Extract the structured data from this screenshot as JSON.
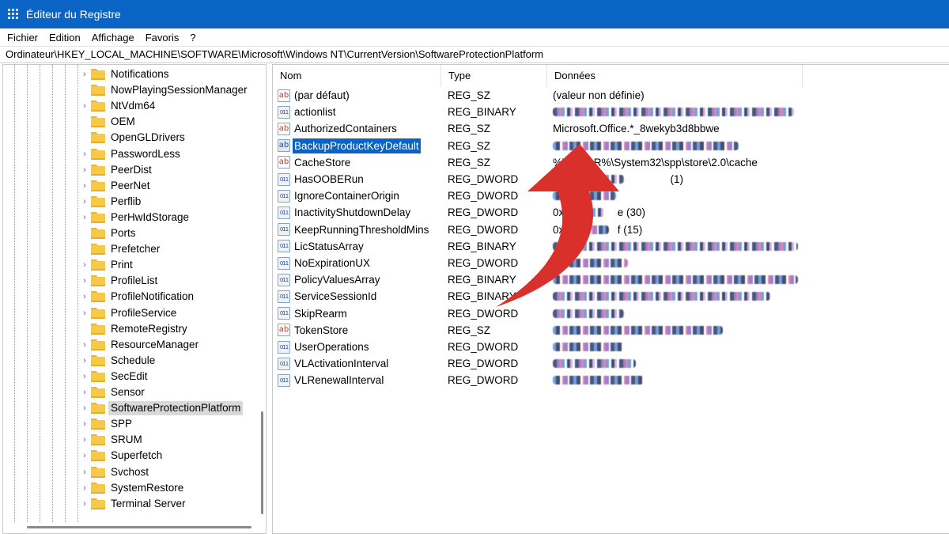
{
  "window": {
    "title": "Éditeur du Registre"
  },
  "menu": [
    "Fichier",
    "Edition",
    "Affichage",
    "Favoris",
    "?"
  ],
  "address": "Ordinateur\\HKEY_LOCAL_MACHINE\\SOFTWARE\\Microsoft\\Windows NT\\CurrentVersion\\SoftwareProtectionPlatform",
  "tree": {
    "items": [
      {
        "label": "Notifications",
        "expandable": true
      },
      {
        "label": "NowPlayingSessionManager",
        "expandable": false
      },
      {
        "label": "NtVdm64",
        "expandable": true
      },
      {
        "label": "OEM",
        "expandable": false
      },
      {
        "label": "OpenGLDrivers",
        "expandable": false
      },
      {
        "label": "PasswordLess",
        "expandable": true
      },
      {
        "label": "PeerDist",
        "expandable": true
      },
      {
        "label": "PeerNet",
        "expandable": true
      },
      {
        "label": "Perflib",
        "expandable": true
      },
      {
        "label": "PerHwIdStorage",
        "expandable": true
      },
      {
        "label": "Ports",
        "expandable": false
      },
      {
        "label": "Prefetcher",
        "expandable": false
      },
      {
        "label": "Print",
        "expandable": true
      },
      {
        "label": "ProfileList",
        "expandable": true
      },
      {
        "label": "ProfileNotification",
        "expandable": true
      },
      {
        "label": "ProfileService",
        "expandable": true
      },
      {
        "label": "RemoteRegistry",
        "expandable": false
      },
      {
        "label": "ResourceManager",
        "expandable": true
      },
      {
        "label": "Schedule",
        "expandable": true
      },
      {
        "label": "SecEdit",
        "expandable": true
      },
      {
        "label": "Sensor",
        "expandable": true
      },
      {
        "label": "SoftwareProtectionPlatform",
        "expandable": true,
        "selected": true
      },
      {
        "label": "SPP",
        "expandable": true
      },
      {
        "label": "SRUM",
        "expandable": true
      },
      {
        "label": "Superfetch",
        "expandable": true
      },
      {
        "label": "Svchost",
        "expandable": true
      },
      {
        "label": "SystemRestore",
        "expandable": true
      },
      {
        "label": "Terminal Server",
        "expandable": true
      }
    ]
  },
  "columns": {
    "name": "Nom",
    "type": "Type",
    "data": "Données"
  },
  "values": [
    {
      "name": "(par défaut)",
      "type": "REG_SZ",
      "icon": "string-value-icon",
      "data": "(valeur non définie)"
    },
    {
      "name": "actionlist",
      "type": "REG_BINARY",
      "icon": "binary-value-icon",
      "data": ""
    },
    {
      "name": "AuthorizedContainers",
      "type": "REG_SZ",
      "icon": "string-value-icon",
      "data": "Microsoft.Office.*_8wekyb3d8bbwe"
    },
    {
      "name": "BackupProductKeyDefault",
      "type": "REG_SZ",
      "icon": "string-value-icon",
      "data": "",
      "selected": true
    },
    {
      "name": "CacheStore",
      "type": "REG_SZ",
      "icon": "string-value-icon",
      "data": "%W  R%\\System32\\spp\\store\\2.0\\cache"
    },
    {
      "name": "HasOOBERun",
      "type": "REG_DWORD",
      "icon": "binary-value-icon",
      "data": "           (1)"
    },
    {
      "name": "IgnoreContainerOrigin",
      "type": "REG_DWORD",
      "icon": "binary-value-icon",
      "data": ""
    },
    {
      "name": "InactivityShutdownDelay",
      "type": "REG_DWORD",
      "icon": "binary-value-icon",
      "data": "0x     e (30)"
    },
    {
      "name": "KeepRunningThresholdMins",
      "type": "REG_DWORD",
      "icon": "binary-value-icon",
      "data": "0x     f (15)"
    },
    {
      "name": "LicStatusArray",
      "type": "REG_BINARY",
      "icon": "binary-value-icon",
      "data": ""
    },
    {
      "name": "NoExpirationUX",
      "type": "REG_DWORD",
      "icon": "binary-value-icon",
      "data": ""
    },
    {
      "name": "PolicyValuesArray",
      "type": "REG_BINARY",
      "icon": "binary-value-icon",
      "data": ""
    },
    {
      "name": "ServiceSessionId",
      "type": "REG_BINARY",
      "icon": "binary-value-icon",
      "data": ""
    },
    {
      "name": "SkipRearm",
      "type": "REG_DWORD",
      "icon": "binary-value-icon",
      "data": ""
    },
    {
      "name": "TokenStore",
      "type": "REG_SZ",
      "icon": "string-value-icon",
      "data": ""
    },
    {
      "name": "UserOperations",
      "type": "REG_DWORD",
      "icon": "binary-value-icon",
      "data": ""
    },
    {
      "name": "VLActivationInterval",
      "type": "REG_DWORD",
      "icon": "binary-value-icon",
      "data": ""
    },
    {
      "name": "VLRenewalInterval",
      "type": "REG_DWORD",
      "icon": "binary-value-icon",
      "data": ""
    }
  ],
  "colors": {
    "titlebar": "#0a64c6",
    "selection": "#0a64c6",
    "arrow": "#d9302b",
    "folder": "#f7c948"
  },
  "icons": {
    "app": "registry-editor-icon",
    "folder": "folder-icon",
    "expand": "chevron-right-icon",
    "annotation": "curved-arrow-icon"
  }
}
